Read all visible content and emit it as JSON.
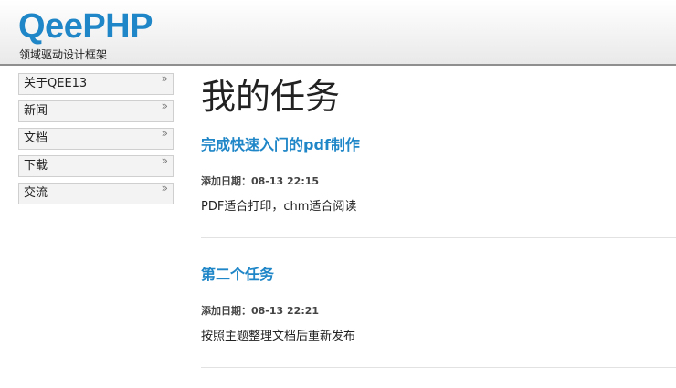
{
  "header": {
    "logo": "QeePHP",
    "tagline": "领域驱动设计框架"
  },
  "sidebar": {
    "items": [
      {
        "label": "关于QEE13",
        "arrow": "»"
      },
      {
        "label": "新闻",
        "arrow": "»"
      },
      {
        "label": "文档",
        "arrow": "»"
      },
      {
        "label": "下载",
        "arrow": "»"
      },
      {
        "label": "交流",
        "arrow": "»"
      }
    ]
  },
  "main": {
    "title": "我的任务",
    "tasks": [
      {
        "title": "完成快速入门的pdf制作",
        "date": "添加日期：08-13 22:15",
        "description": "PDF适合打印，chm适合阅读"
      },
      {
        "title": "第二个任务",
        "date": "添加日期：08-13 22:21",
        "description": "按照主题整理文档后重新发布"
      }
    ]
  },
  "colors": {
    "accent": "#1f86c7",
    "header_border": "#8f8f8f"
  }
}
